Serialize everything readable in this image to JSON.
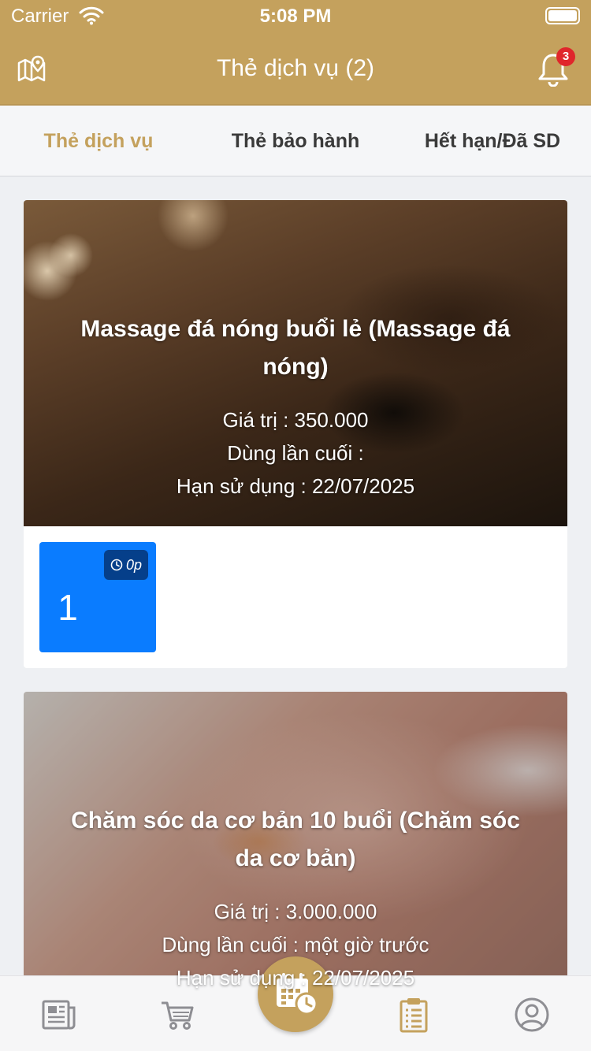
{
  "status_bar": {
    "carrier": "Carrier",
    "time": "5:08 PM"
  },
  "header": {
    "title": "Thẻ dịch vụ (2)",
    "notification_count": "3"
  },
  "tabs": [
    {
      "label": "Thẻ dịch vụ",
      "active": true
    },
    {
      "label": "Thẻ bảo hành",
      "active": false
    },
    {
      "label": "Hết hạn/Đã SD",
      "active": false
    }
  ],
  "cards": [
    {
      "name": "Massage đá nóng buổi lẻ (Massage đá nóng)",
      "value_line": "Giá trị : 350.000",
      "last_used_line": "Dùng lần cuối :",
      "expiry_line": "Hạn sử dụng : 22/07/2025",
      "sessions": [
        {
          "duration": "0p",
          "count": "1"
        }
      ]
    },
    {
      "name": "Chăm sóc da cơ bản 10 buổi (Chăm sóc da cơ bản)",
      "value_line": "Giá trị : 3.000.000",
      "last_used_line": "Dùng lần cuối : một giờ trước",
      "expiry_line": "Hạn sử dụng : 22/07/2025"
    }
  ],
  "bottom_nav": {
    "items": [
      "news-icon",
      "cart-icon",
      "calendar-clock-icon",
      "clipboard-list-icon",
      "user-circle-icon"
    ],
    "active_item": "clipboard-list-icon"
  },
  "colors": {
    "brand": "#c4a15d",
    "session_blue": "#0a7cff",
    "badge_red": "#e0262b"
  }
}
